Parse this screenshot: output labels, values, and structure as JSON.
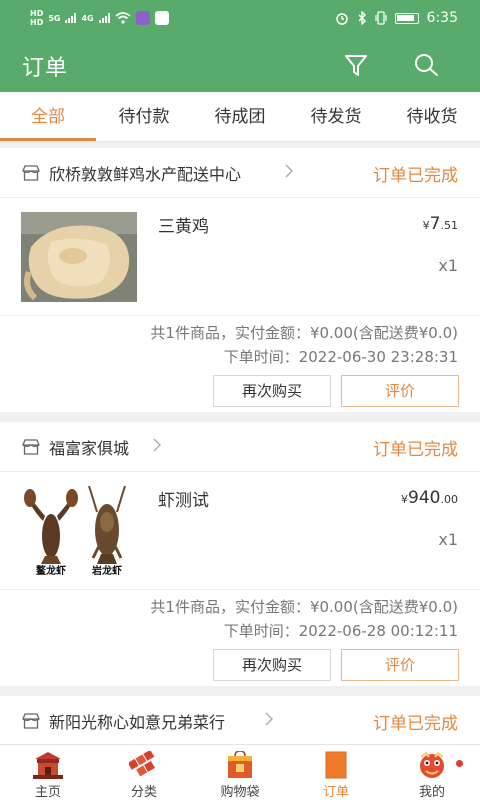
{
  "status_bar": {
    "left_top": "HD",
    "left_bottom": "HD",
    "net1": "5G",
    "net2": "4G",
    "time": "6:35"
  },
  "app_bar": {
    "title": "订单",
    "filter_icon": "filter-icon",
    "search_icon": "search-icon",
    "color": "#58ab6b"
  },
  "tabs": [
    {
      "label": "全部",
      "active": true
    },
    {
      "label": "待付款",
      "active": false
    },
    {
      "label": "待成团",
      "active": false
    },
    {
      "label": "待发货",
      "active": false
    },
    {
      "label": "待收货",
      "active": false
    }
  ],
  "accent_color": "#e4883f",
  "orders": [
    {
      "shop_name": "欣桥敦敦鲜鸡水产配送中心",
      "status": "订单已完成",
      "item": {
        "name": "三黄鸡",
        "price_currency": "¥",
        "price_int": "7",
        "price_dec": ".51",
        "qty": "x1"
      },
      "summary": "共1件商品，实付金额：¥0.00(含配送费¥0.0)",
      "order_time": "下单时间：2022-06-30 23:28:31",
      "rebuy_label": "再次购买",
      "review_label": "评价"
    },
    {
      "shop_name": "福富家俱城",
      "status": "订单已完成",
      "item": {
        "name": "虾测试",
        "price_currency": "¥",
        "price_int": "940",
        "price_dec": ".00",
        "qty": "x1",
        "image_caption_left": "鳌龙虾",
        "image_caption_right": "岩龙虾"
      },
      "summary": "共1件商品，实付金额：¥0.00(含配送费¥0.0)",
      "order_time": "下单时间：2022-06-28 00:12:11",
      "rebuy_label": "再次购买",
      "review_label": "评价"
    },
    {
      "shop_name": "新阳光称心如意兄弟菜行",
      "status": "订单已完成"
    }
  ],
  "bottom_nav": [
    {
      "label": "主页",
      "icon": "home-icon",
      "active": false
    },
    {
      "label": "分类",
      "icon": "category-icon",
      "active": false
    },
    {
      "label": "购物袋",
      "icon": "shopping-bag-icon",
      "active": false
    },
    {
      "label": "订单",
      "icon": "orders-icon",
      "active": true
    },
    {
      "label": "我的",
      "icon": "profile-icon",
      "active": false,
      "badge": true
    }
  ]
}
